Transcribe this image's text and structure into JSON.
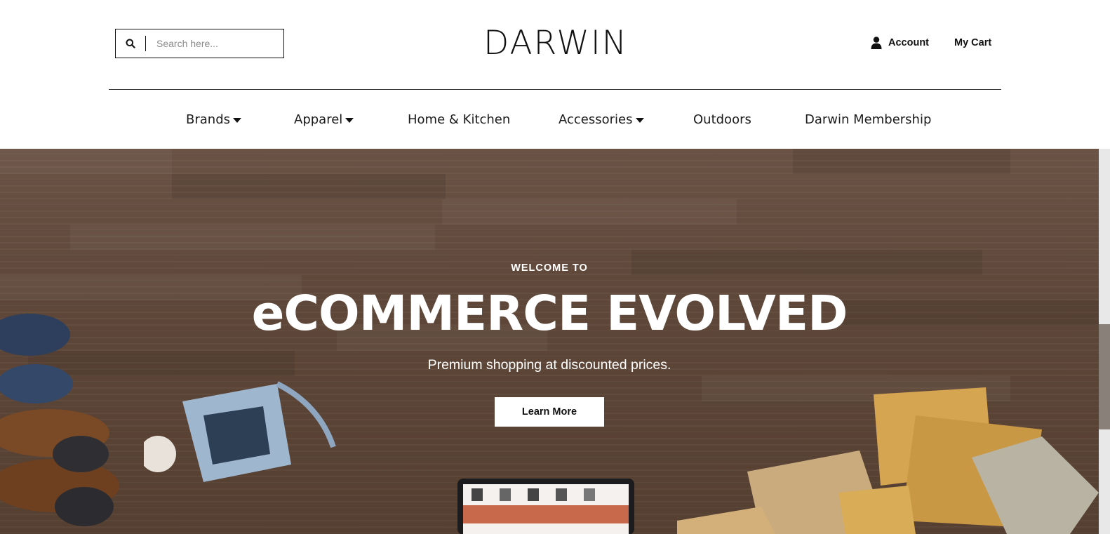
{
  "header": {
    "search_placeholder": "Search here...",
    "logo_text": "DARWIN",
    "account_label": "Account",
    "cart_label": "My Cart"
  },
  "nav": {
    "items": [
      {
        "label": "Brands",
        "has_dropdown": true
      },
      {
        "label": "Apparel",
        "has_dropdown": true
      },
      {
        "label": "Home & Kitchen",
        "has_dropdown": false
      },
      {
        "label": "Accessories",
        "has_dropdown": true
      },
      {
        "label": "Outdoors",
        "has_dropdown": false
      },
      {
        "label": "Darwin Membership",
        "has_dropdown": false
      }
    ]
  },
  "hero": {
    "eyebrow": "WELCOME TO",
    "headline": "eCOMMERCE EVOLVED",
    "tagline": "Premium shopping at discounted prices.",
    "cta_label": "Learn More"
  },
  "icons": {
    "search": "search-icon",
    "account": "user-icon",
    "dropdown": "caret-down-icon"
  },
  "colors": {
    "text": "#111111",
    "hero_wood": "#5e4739",
    "cta_bg": "#ffffff"
  }
}
